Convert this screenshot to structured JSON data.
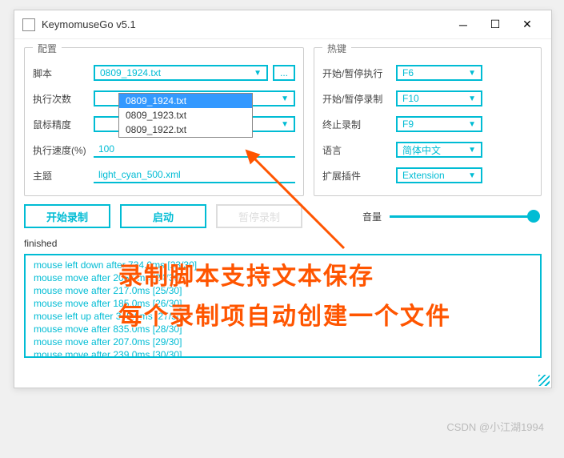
{
  "window": {
    "title": "KeymomuseGo v5.1"
  },
  "config": {
    "panel_title": "配置",
    "script_label": "脚本",
    "script_value": "0809_1924.txt",
    "options": [
      "0809_1924.txt",
      "0809_1923.txt",
      "0809_1922.txt"
    ],
    "repeat_label": "执行次数",
    "repeat_value": "",
    "precision_label": "鼠标精度",
    "precision_value": "",
    "speed_label": "执行速度(%)",
    "speed_value": "100",
    "theme_label": "主题",
    "theme_value": "light_cyan_500.xml",
    "browse": "..."
  },
  "hotkey": {
    "panel_title": "热键",
    "start_exec_label": "开始/暂停执行",
    "start_exec_value": "F6",
    "start_rec_label": "开始/暂停录制",
    "start_rec_value": "F10",
    "stop_rec_label": "终止录制",
    "stop_rec_value": "F9",
    "lang_label": "语言",
    "lang_value": "简体中文",
    "ext_label": "扩展插件",
    "ext_value": "Extension"
  },
  "buttons": {
    "start_rec": "开始录制",
    "launch": "启动",
    "pause_rec": "暂停录制"
  },
  "volume": {
    "label": "音量"
  },
  "status": "finished",
  "log_lines": [
    "mouse left down after 734.0ms [23/30]",
    "mouse move after 205.0ms [24/30]",
    "mouse move after 217.0ms [25/30]",
    "mouse move after 185.0ms [26/30]",
    "mouse left up after 375.0ms [27/30]",
    "mouse move after 835.0ms [28/30]",
    "mouse move after 207.0ms [29/30]",
    "mouse move after 239.0ms [30/30]"
  ],
  "annotations": {
    "line1": "录制脚本支持文本保存",
    "line2": "每个录制项自动创建一个文件"
  },
  "credit": "CSDN @小江湖1994"
}
